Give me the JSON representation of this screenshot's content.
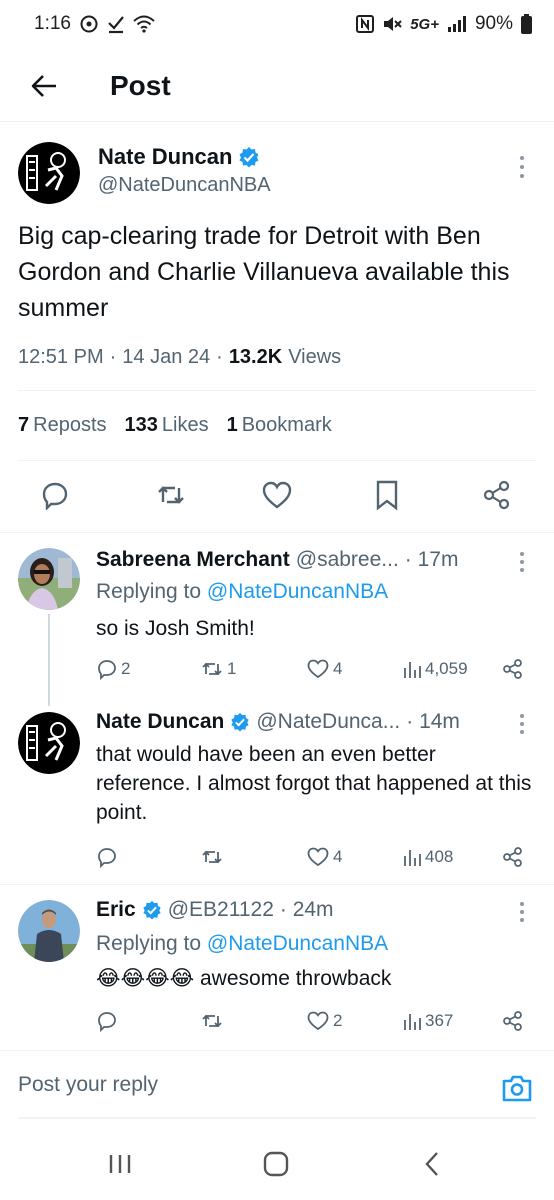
{
  "status_bar": {
    "time": "1:16",
    "network": "5G+",
    "battery": "90%",
    "left_icons": [
      "data-saver-icon",
      "check-download-icon",
      "wifi-icon"
    ],
    "right_icons": [
      "nfc-icon",
      "mute-icon",
      "signal-icon",
      "battery-icon"
    ]
  },
  "header": {
    "title": "Post",
    "back_icon": "arrow-left-icon"
  },
  "main_post": {
    "author_name": "Nate Duncan",
    "handle": "@NateDuncanNBA",
    "verified": true,
    "text": "Big cap-clearing trade for Detroit with Ben Gordon and Charlie Villanueva available this summer",
    "time": "12:51 PM",
    "date": "14 Jan 24",
    "views_count": "13.2K",
    "views_label": "Views",
    "reposts_count": "7",
    "reposts_label": "Reposts",
    "likes_count": "133",
    "likes_label": "Likes",
    "bookmarks_count": "1",
    "bookmarks_label": "Bookmark",
    "actions": [
      "reply-icon",
      "repost-icon",
      "like-icon",
      "bookmark-icon",
      "share-icon"
    ]
  },
  "replies": [
    {
      "name": "Sabreena Merchant",
      "handle": "@sabree...",
      "time": "· 17m",
      "verified": false,
      "replying_label": "Replying to",
      "replying_to": "@NateDuncanNBA",
      "text": "so is Josh Smith!",
      "reply_count": "2",
      "repost_count": "1",
      "like_count": "4",
      "view_count": "4,059"
    },
    {
      "name": "Nate Duncan",
      "handle": "@NateDunca...",
      "time": "· 14m",
      "verified": true,
      "text": "that would have been an even better reference. I almost forgot that happened at this point.",
      "reply_count": "",
      "repost_count": "",
      "like_count": "4",
      "view_count": "408"
    },
    {
      "name": "Eric",
      "handle": "@EB21122",
      "time": "· 24m",
      "verified": true,
      "replying_label": "Replying to",
      "replying_to": "@NateDuncanNBA",
      "emoji": "😂😂😂😂",
      "text": "awesome throwback",
      "reply_count": "",
      "repost_count": "",
      "like_count": "2",
      "view_count": "367"
    }
  ],
  "reply_bar": {
    "placeholder": "Post your reply",
    "camera_icon": "camera-icon"
  },
  "nav_bar": [
    "recents-icon",
    "home-icon",
    "back-icon"
  ],
  "colors": {
    "accent": "#1d9bf0",
    "text": "#0f1419",
    "secondary": "#536471",
    "divider": "#eff3f4"
  }
}
